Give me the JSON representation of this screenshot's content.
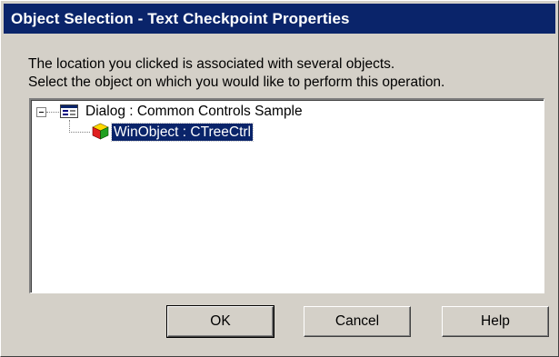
{
  "window": {
    "title": "Object Selection - Text Checkpoint Properties"
  },
  "instructions": {
    "line1": "The location you clicked is associated with several objects.",
    "line2": "Select the object on which you would like to perform this operation."
  },
  "tree": {
    "root": {
      "label": "Dialog : Common Controls Sample",
      "icon": "dialog-window-icon",
      "expanded": true
    },
    "child": {
      "label": "WinObject : CTreeCtrl",
      "icon": "cube-object-icon",
      "selected": true
    }
  },
  "buttons": {
    "ok": "OK",
    "cancel": "Cancel",
    "help": "Help"
  },
  "colors": {
    "titlebar": "#0a246a",
    "dialog_face": "#d4d0c8",
    "selection": "#0a246a"
  }
}
